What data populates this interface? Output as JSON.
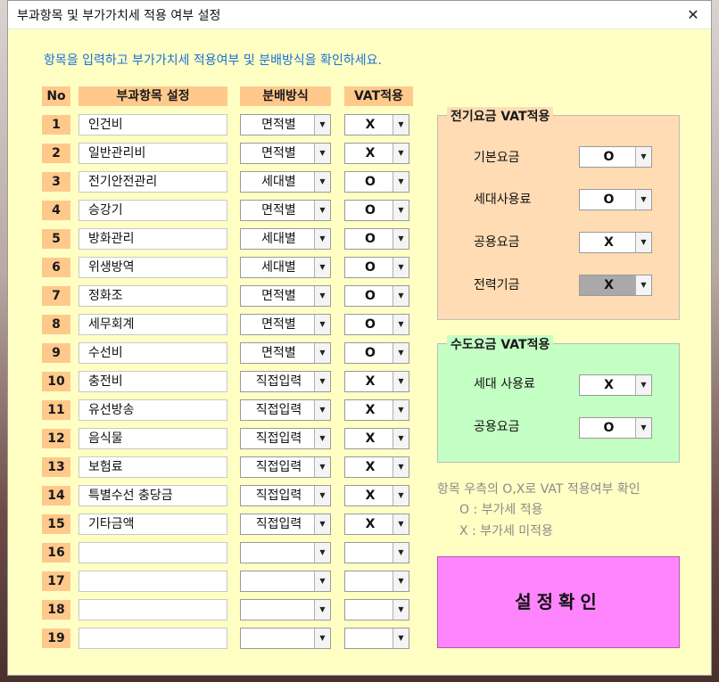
{
  "window": {
    "title": "부과항목 및 부가가치세 적용 여부 설정",
    "close_icon": "close-icon"
  },
  "instruction": "항목을 입력하고 부가가치세 적용여부 및 분배방식을 확인하세요.",
  "headers": {
    "no": "No",
    "item": "부과항목 설정",
    "dist": "분배방식",
    "vat": "VAT적용"
  },
  "rows": [
    {
      "no": "1",
      "item": "인건비",
      "dist": "면적별",
      "vat": "X"
    },
    {
      "no": "2",
      "item": "일반관리비",
      "dist": "면적별",
      "vat": "X"
    },
    {
      "no": "3",
      "item": "전기안전관리",
      "dist": "세대별",
      "vat": "O"
    },
    {
      "no": "4",
      "item": "승강기",
      "dist": "면적별",
      "vat": "O"
    },
    {
      "no": "5",
      "item": "방화관리",
      "dist": "세대별",
      "vat": "O"
    },
    {
      "no": "6",
      "item": "위생방역",
      "dist": "세대별",
      "vat": "O"
    },
    {
      "no": "7",
      "item": "정화조",
      "dist": "면적별",
      "vat": "O"
    },
    {
      "no": "8",
      "item": "세무회계",
      "dist": "면적별",
      "vat": "O"
    },
    {
      "no": "9",
      "item": "수선비",
      "dist": "면적별",
      "vat": "O"
    },
    {
      "no": "10",
      "item": "충전비",
      "dist": "직접입력",
      "vat": "X"
    },
    {
      "no": "11",
      "item": "유선방송",
      "dist": "직접입력",
      "vat": "X"
    },
    {
      "no": "12",
      "item": "음식물",
      "dist": "직접입력",
      "vat": "X"
    },
    {
      "no": "13",
      "item": "보험료",
      "dist": "직접입력",
      "vat": "X"
    },
    {
      "no": "14",
      "item": "특별수선 충당금",
      "dist": "직접입력",
      "vat": "X"
    },
    {
      "no": "15",
      "item": "기타금액",
      "dist": "직접입력",
      "vat": "X"
    },
    {
      "no": "16",
      "item": "",
      "dist": "",
      "vat": ""
    },
    {
      "no": "17",
      "item": "",
      "dist": "",
      "vat": ""
    },
    {
      "no": "18",
      "item": "",
      "dist": "",
      "vat": ""
    },
    {
      "no": "19",
      "item": "",
      "dist": "",
      "vat": ""
    }
  ],
  "electric": {
    "title": "전기요금 VAT적용",
    "items": [
      {
        "label": "기본요금",
        "value": "O"
      },
      {
        "label": "세대사용료",
        "value": "O"
      },
      {
        "label": "공용요금",
        "value": "X"
      },
      {
        "label": "전력기금",
        "value": "X"
      }
    ]
  },
  "water": {
    "title": "수도요금 VAT적용",
    "items": [
      {
        "label": "세대 사용료",
        "value": "X"
      },
      {
        "label": "공용요금",
        "value": "O"
      }
    ]
  },
  "legend": {
    "line1": "항목 우측의 O,X로 VAT 적용여부 확인",
    "line2": "O : 부가세 적용",
    "line3": "X : 부가세 미적용"
  },
  "confirm_button": "설정확인",
  "colors": {
    "form_bg": "#ffffc4",
    "header_bg": "#ffc98c",
    "electric_bg": "#ffdcb4",
    "water_bg": "#c4ffc4",
    "button_bg": "#ff85ff",
    "instruction": "#1a6fd6"
  }
}
